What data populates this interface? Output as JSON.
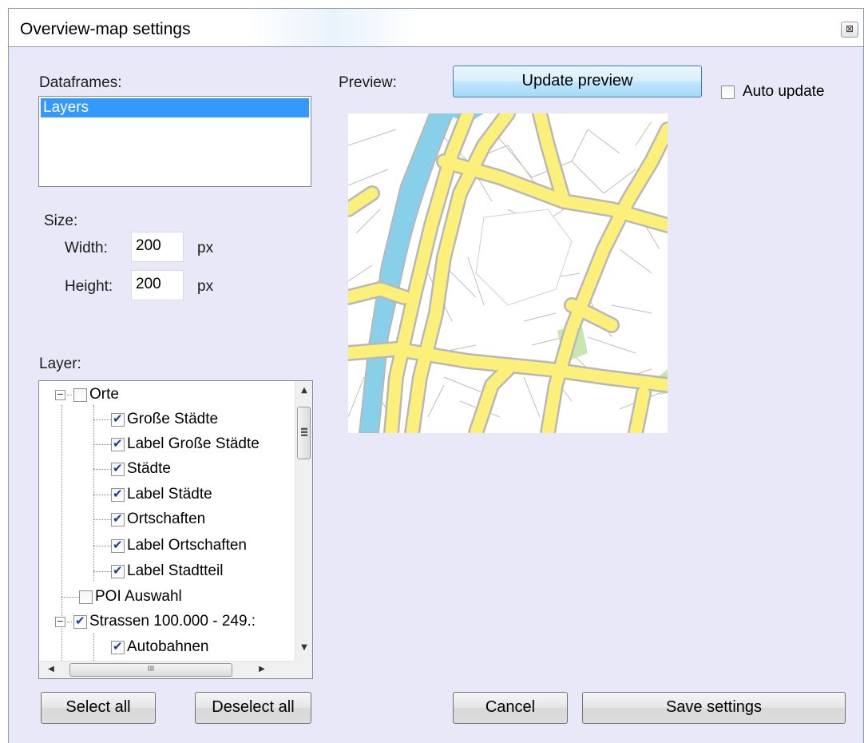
{
  "window": {
    "title": "Overview-map settings",
    "close_glyph": "⊠"
  },
  "dataframes": {
    "label": "Dataframes:",
    "items": [
      "Layers"
    ]
  },
  "size": {
    "label": "Size:",
    "width_label": "Width:",
    "width_value": "200",
    "width_unit": "px",
    "height_label": "Height:",
    "height_value": "200",
    "height_unit": "px"
  },
  "layer": {
    "label": "Layer:",
    "tree": [
      {
        "label": "Orte",
        "checked": false,
        "expander": "−"
      },
      {
        "label": "Große Städte",
        "checked": true
      },
      {
        "label": "Label Große Städte",
        "checked": true
      },
      {
        "label": "Städte",
        "checked": true
      },
      {
        "label": "Label Städte",
        "checked": true
      },
      {
        "label": "Ortschaften",
        "checked": true
      },
      {
        "label": "Label Ortschaften",
        "checked": true
      },
      {
        "label": "Label Stadtteil",
        "checked": true
      },
      {
        "label": "POI Auswahl",
        "checked": false
      },
      {
        "label": "Strassen 100.000 - 249.:",
        "checked": true,
        "expander": "−"
      },
      {
        "label": "Autobahnen",
        "checked": true
      }
    ],
    "hscroll_grip": "III"
  },
  "preview": {
    "label": "Preview:",
    "update_button": "Update preview",
    "auto_update_label": "Auto update",
    "auto_update_checked": false,
    "colors": {
      "road": "#fcf07a",
      "road_outline": "#b8b8b8",
      "water": "#88cfea",
      "park": "#c8e6b0",
      "background": "#ffffff"
    }
  },
  "buttons": {
    "select_all": "Select all",
    "deselect_all": "Deselect all",
    "cancel": "Cancel",
    "save": "Save settings"
  }
}
